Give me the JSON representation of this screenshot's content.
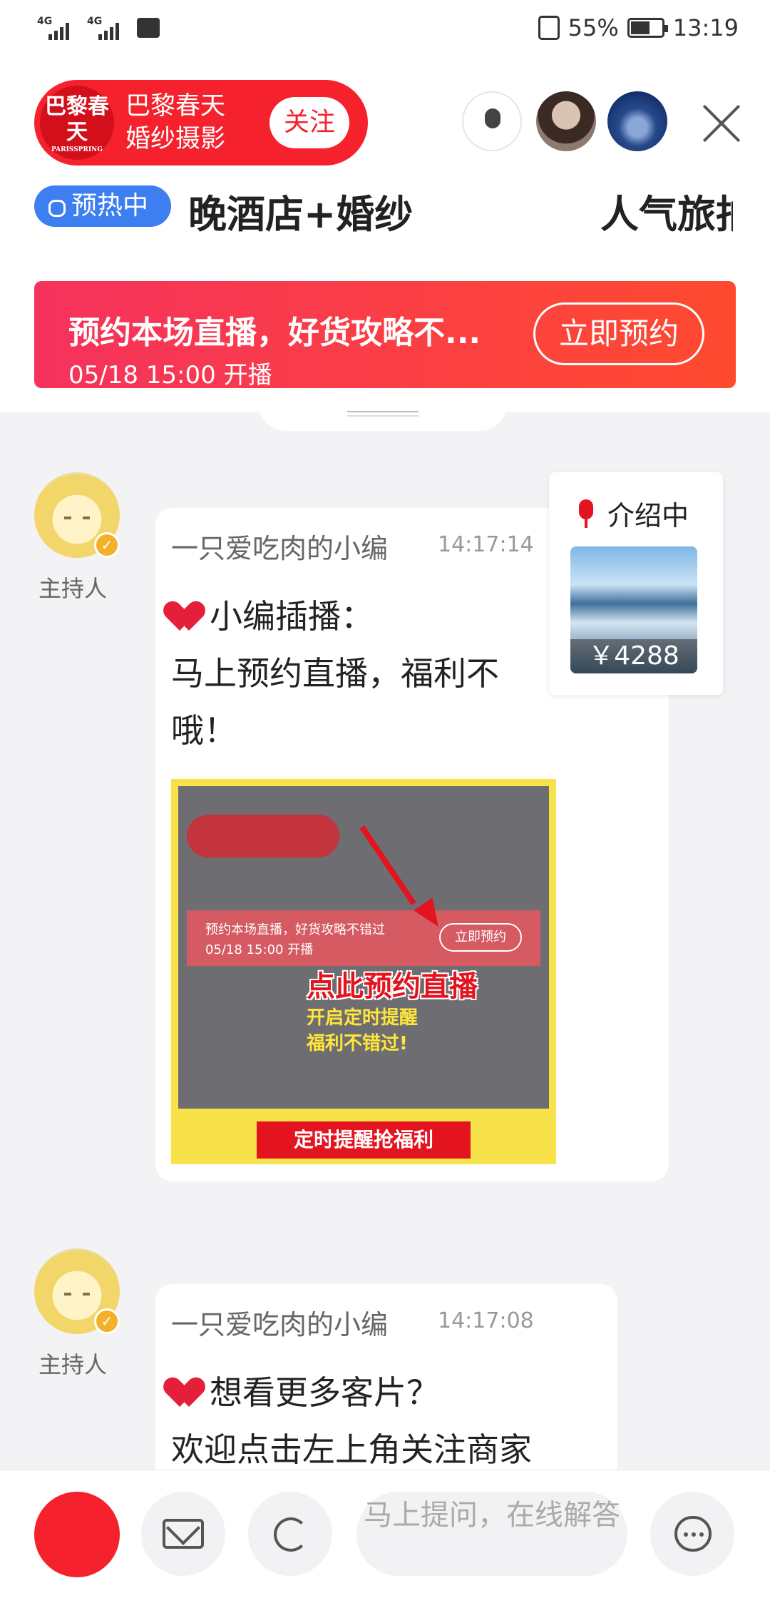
{
  "status": {
    "net1": "4G",
    "net2": "4G",
    "battery_pct": "55%",
    "time": "13:19"
  },
  "header": {
    "logo_text": "巴黎春天",
    "logo_small": "PARISSPRING",
    "shop_name": "巴黎春天 婚纱摄影",
    "follow_label": "关注",
    "preheat_label": "预热中",
    "marquee_left": "晚酒店+婚纱",
    "marquee_right": "人气旅拍",
    "reserve_title": "预约本场直播，好货攻略不...",
    "reserve_time": "05/18 15:00 开播",
    "reserve_button": "立即预约"
  },
  "messages": [
    {
      "author": "一只爱吃肉的小编",
      "time": "14:17:14",
      "role": "主持人",
      "lines": [
        "小编插播：",
        "马上预约直播，福利不",
        "哦！"
      ],
      "promo": {
        "bar_title": "预约本场直播，好货攻略不错过",
        "bar_time": "05/18 15:00 开播",
        "bar_button": "立即预约",
        "cta": "点此预约直播",
        "line1": "开启定时提醒",
        "line2": "福利不错过!",
        "ribbon": "定时提醒抢福利"
      }
    },
    {
      "author": "一只爱吃肉的小编",
      "time": "14:17:08",
      "role": "主持人",
      "lines": [
        "想看更多客片？",
        "欢迎点击左上角关注商家"
      ]
    }
  ],
  "intro_card": {
    "label": "介绍中",
    "price": "￥4288"
  },
  "bottom": {
    "ask_placeholder": "马上提问，在线解答"
  }
}
